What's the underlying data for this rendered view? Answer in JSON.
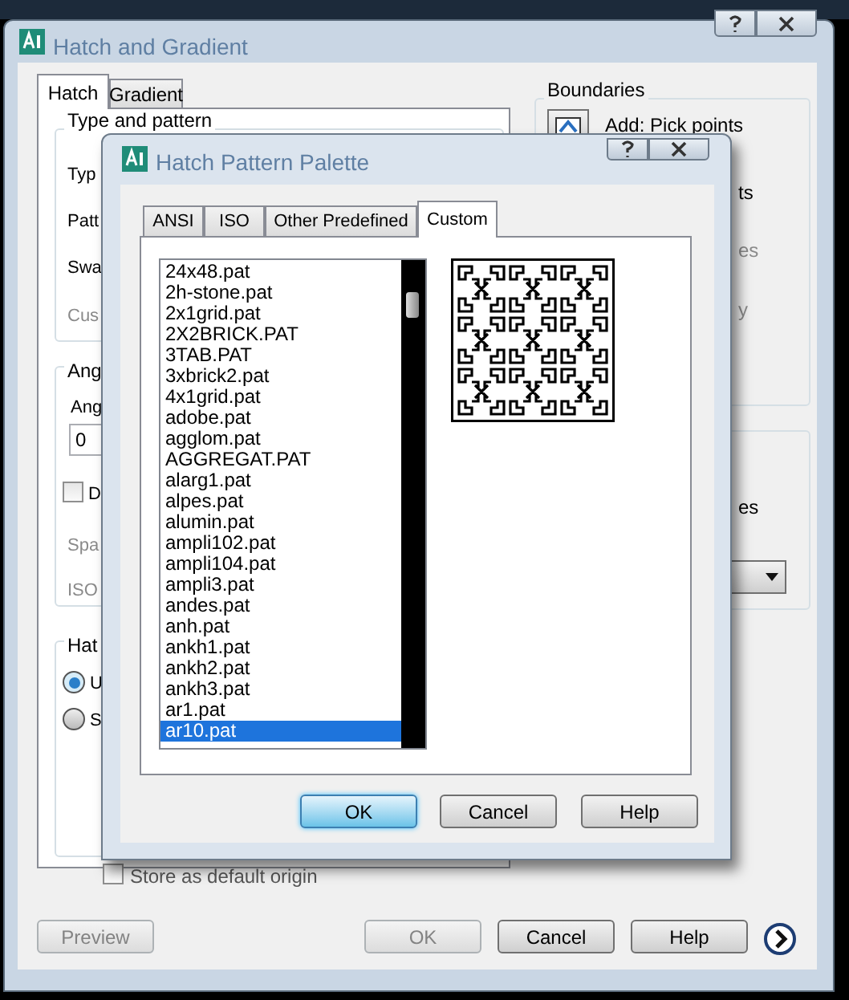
{
  "main_dialog": {
    "title": "Hatch and Gradient",
    "tabs": [
      {
        "label": "Hatch",
        "selected": true
      },
      {
        "label": "Gradient",
        "selected": false
      }
    ],
    "type_and_pattern": {
      "title": "Type and pattern",
      "labels": [
        {
          "text": "Typ",
          "disabled": false
        },
        {
          "text": "Patt",
          "disabled": false
        },
        {
          "text": "Swa",
          "disabled": false
        },
        {
          "text": "Cus",
          "disabled": true
        }
      ]
    },
    "angle_and_scale": {
      "title": "Ang",
      "angle_label": "Ang",
      "angle_value": "0",
      "checkbox": {
        "label": "D",
        "checked": false
      },
      "labels": [
        {
          "text": "Spa",
          "disabled": true
        },
        {
          "text": "ISO",
          "disabled": true
        }
      ]
    },
    "hatch_origin": {
      "title": "Hat",
      "radios": [
        {
          "label": "U",
          "selected": true
        },
        {
          "label": "S",
          "selected": false
        }
      ],
      "store_default": {
        "label": "Store as default origin",
        "checked": false
      }
    },
    "boundaries": {
      "title": "Boundaries",
      "items": [
        {
          "text": "Add: Pick points",
          "disabled": false
        },
        {
          "text": "ts",
          "disabled": false
        },
        {
          "text": "es",
          "disabled": true
        },
        {
          "text": "y",
          "disabled": true
        }
      ]
    },
    "options": {
      "items": [
        {
          "text": "es",
          "disabled": false
        }
      ]
    },
    "buttons": [
      {
        "label": "Preview",
        "disabled": true
      },
      {
        "label": "OK",
        "disabled": true
      },
      {
        "label": "Cancel",
        "disabled": false
      },
      {
        "label": "Help",
        "disabled": false
      }
    ]
  },
  "palette": {
    "title": "Hatch Pattern Palette",
    "tabs": [
      {
        "label": "ANSI",
        "selected": false
      },
      {
        "label": "ISO",
        "selected": false
      },
      {
        "label": "Other Predefined",
        "selected": false
      },
      {
        "label": "Custom",
        "selected": true
      }
    ],
    "patterns": [
      {
        "name": "24x48.pat",
        "selected": false
      },
      {
        "name": "2h-stone.pat",
        "selected": false
      },
      {
        "name": "2x1grid.pat",
        "selected": false
      },
      {
        "name": "2X2BRICK.PAT",
        "selected": false
      },
      {
        "name": "3TAB.PAT",
        "selected": false
      },
      {
        "name": "3xbrick2.pat",
        "selected": false
      },
      {
        "name": "4x1grid.pat",
        "selected": false
      },
      {
        "name": "adobe.pat",
        "selected": false
      },
      {
        "name": "agglom.pat",
        "selected": false
      },
      {
        "name": "AGGREGAT.PAT",
        "selected": false
      },
      {
        "name": "alarg1.pat",
        "selected": false
      },
      {
        "name": "alpes.pat",
        "selected": false
      },
      {
        "name": "alumin.pat",
        "selected": false
      },
      {
        "name": "ampli102.pat",
        "selected": false
      },
      {
        "name": "ampli104.pat",
        "selected": false
      },
      {
        "name": "ampli3.pat",
        "selected": false
      },
      {
        "name": "andes.pat",
        "selected": false
      },
      {
        "name": "anh.pat",
        "selected": false
      },
      {
        "name": "ankh1.pat",
        "selected": false
      },
      {
        "name": "ankh2.pat",
        "selected": false
      },
      {
        "name": "ankh3.pat",
        "selected": false
      },
      {
        "name": "ar1.pat",
        "selected": false
      },
      {
        "name": "ar10.pat",
        "selected": true
      }
    ],
    "buttons": [
      {
        "label": "OK",
        "default": true
      },
      {
        "label": "Cancel",
        "default": false
      },
      {
        "label": "Help",
        "default": false
      }
    ]
  }
}
